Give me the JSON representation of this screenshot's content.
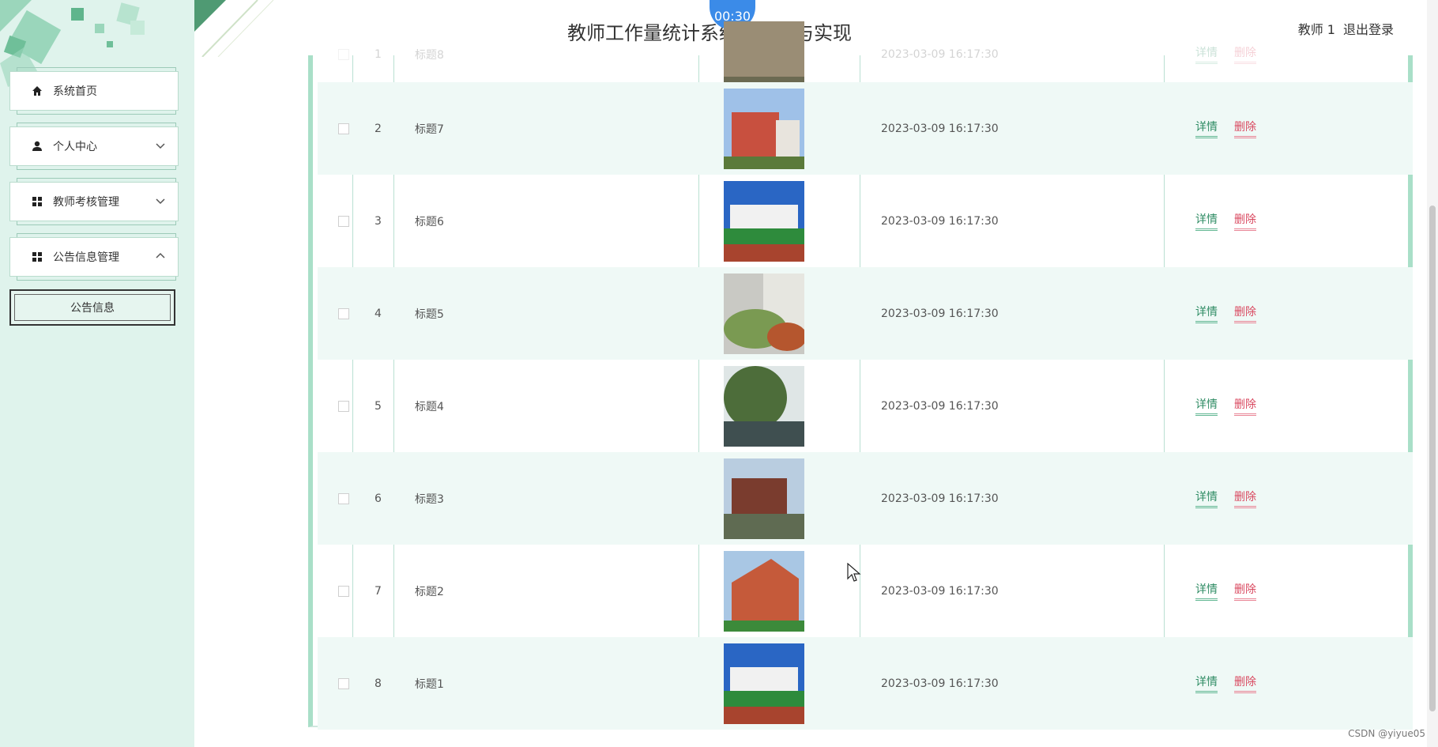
{
  "header": {
    "title": "教师工作量统计系统的设计与实现",
    "timer": "00:30",
    "user": "教师 1",
    "logout": "退出登录"
  },
  "sidebar": {
    "items": [
      {
        "label": "系统首页",
        "icon": "home-icon"
      },
      {
        "label": "个人中心",
        "icon": "user-icon"
      },
      {
        "label": "教师考核管理",
        "icon": "grid-icon"
      },
      {
        "label": "公告信息管理",
        "icon": "grid-icon"
      }
    ],
    "sub_item": "公告信息"
  },
  "table": {
    "rows": [
      {
        "num": "1",
        "title": "标题8",
        "date": "2023-03-09 16:17:30",
        "detail": "详情",
        "delete": "删除"
      },
      {
        "num": "2",
        "title": "标题7",
        "date": "2023-03-09 16:17:30",
        "detail": "详情",
        "delete": "删除"
      },
      {
        "num": "3",
        "title": "标题6",
        "date": "2023-03-09 16:17:30",
        "detail": "详情",
        "delete": "删除"
      },
      {
        "num": "4",
        "title": "标题5",
        "date": "2023-03-09 16:17:30",
        "detail": "详情",
        "delete": "删除"
      },
      {
        "num": "5",
        "title": "标题4",
        "date": "2023-03-09 16:17:30",
        "detail": "详情",
        "delete": "删除"
      },
      {
        "num": "6",
        "title": "标题3",
        "date": "2023-03-09 16:17:30",
        "detail": "详情",
        "delete": "删除"
      },
      {
        "num": "7",
        "title": "标题2",
        "date": "2023-03-09 16:17:30",
        "detail": "详情",
        "delete": "删除"
      },
      {
        "num": "8",
        "title": "标题1",
        "date": "2023-03-09 16:17:30",
        "detail": "详情",
        "delete": "删除"
      }
    ]
  },
  "watermark": "CSDN @yiyue05",
  "colors": {
    "accent": "#a9dfc8",
    "detail": "#2f8c64",
    "delete": "#d9485f",
    "sidebar": "#dff3ec"
  }
}
